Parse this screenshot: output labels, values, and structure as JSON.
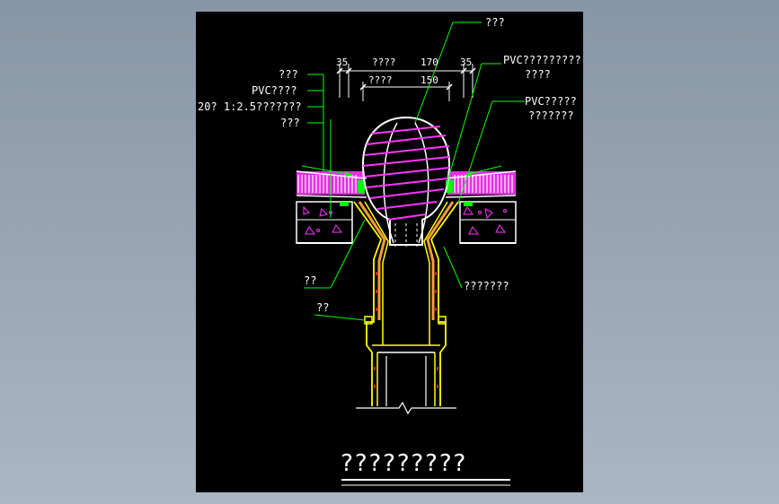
{
  "drawing": {
    "title": "?????????",
    "labels": {
      "top": "???",
      "pvc_top_right_line1": "PVC?????????",
      "pvc_top_right_line2": "????",
      "pvc_right_line1": "PVC?????",
      "pvc_right_line2": "???????",
      "left_1": "???",
      "left_2": "PVC????",
      "left_3": "20? 1:2.5???????",
      "left_4": "???",
      "left_mid": "??",
      "left_low": "??",
      "right_mid": "???????"
    },
    "dimensions": {
      "d35_left": "35",
      "d35_right": "35",
      "d170": "170",
      "d150": "150",
      "d170_label": "????",
      "d150_label": "????"
    },
    "colors": {
      "background": "#8e9cab",
      "sheet": "#000000",
      "line": "#ffffff",
      "leader": "#00ff00",
      "pipe": "#ffff00",
      "pipe_fill": "#ff9a3c",
      "dome": "#ff33ff",
      "membrane": "#9b30ff",
      "hatch": "#00ff00"
    }
  }
}
